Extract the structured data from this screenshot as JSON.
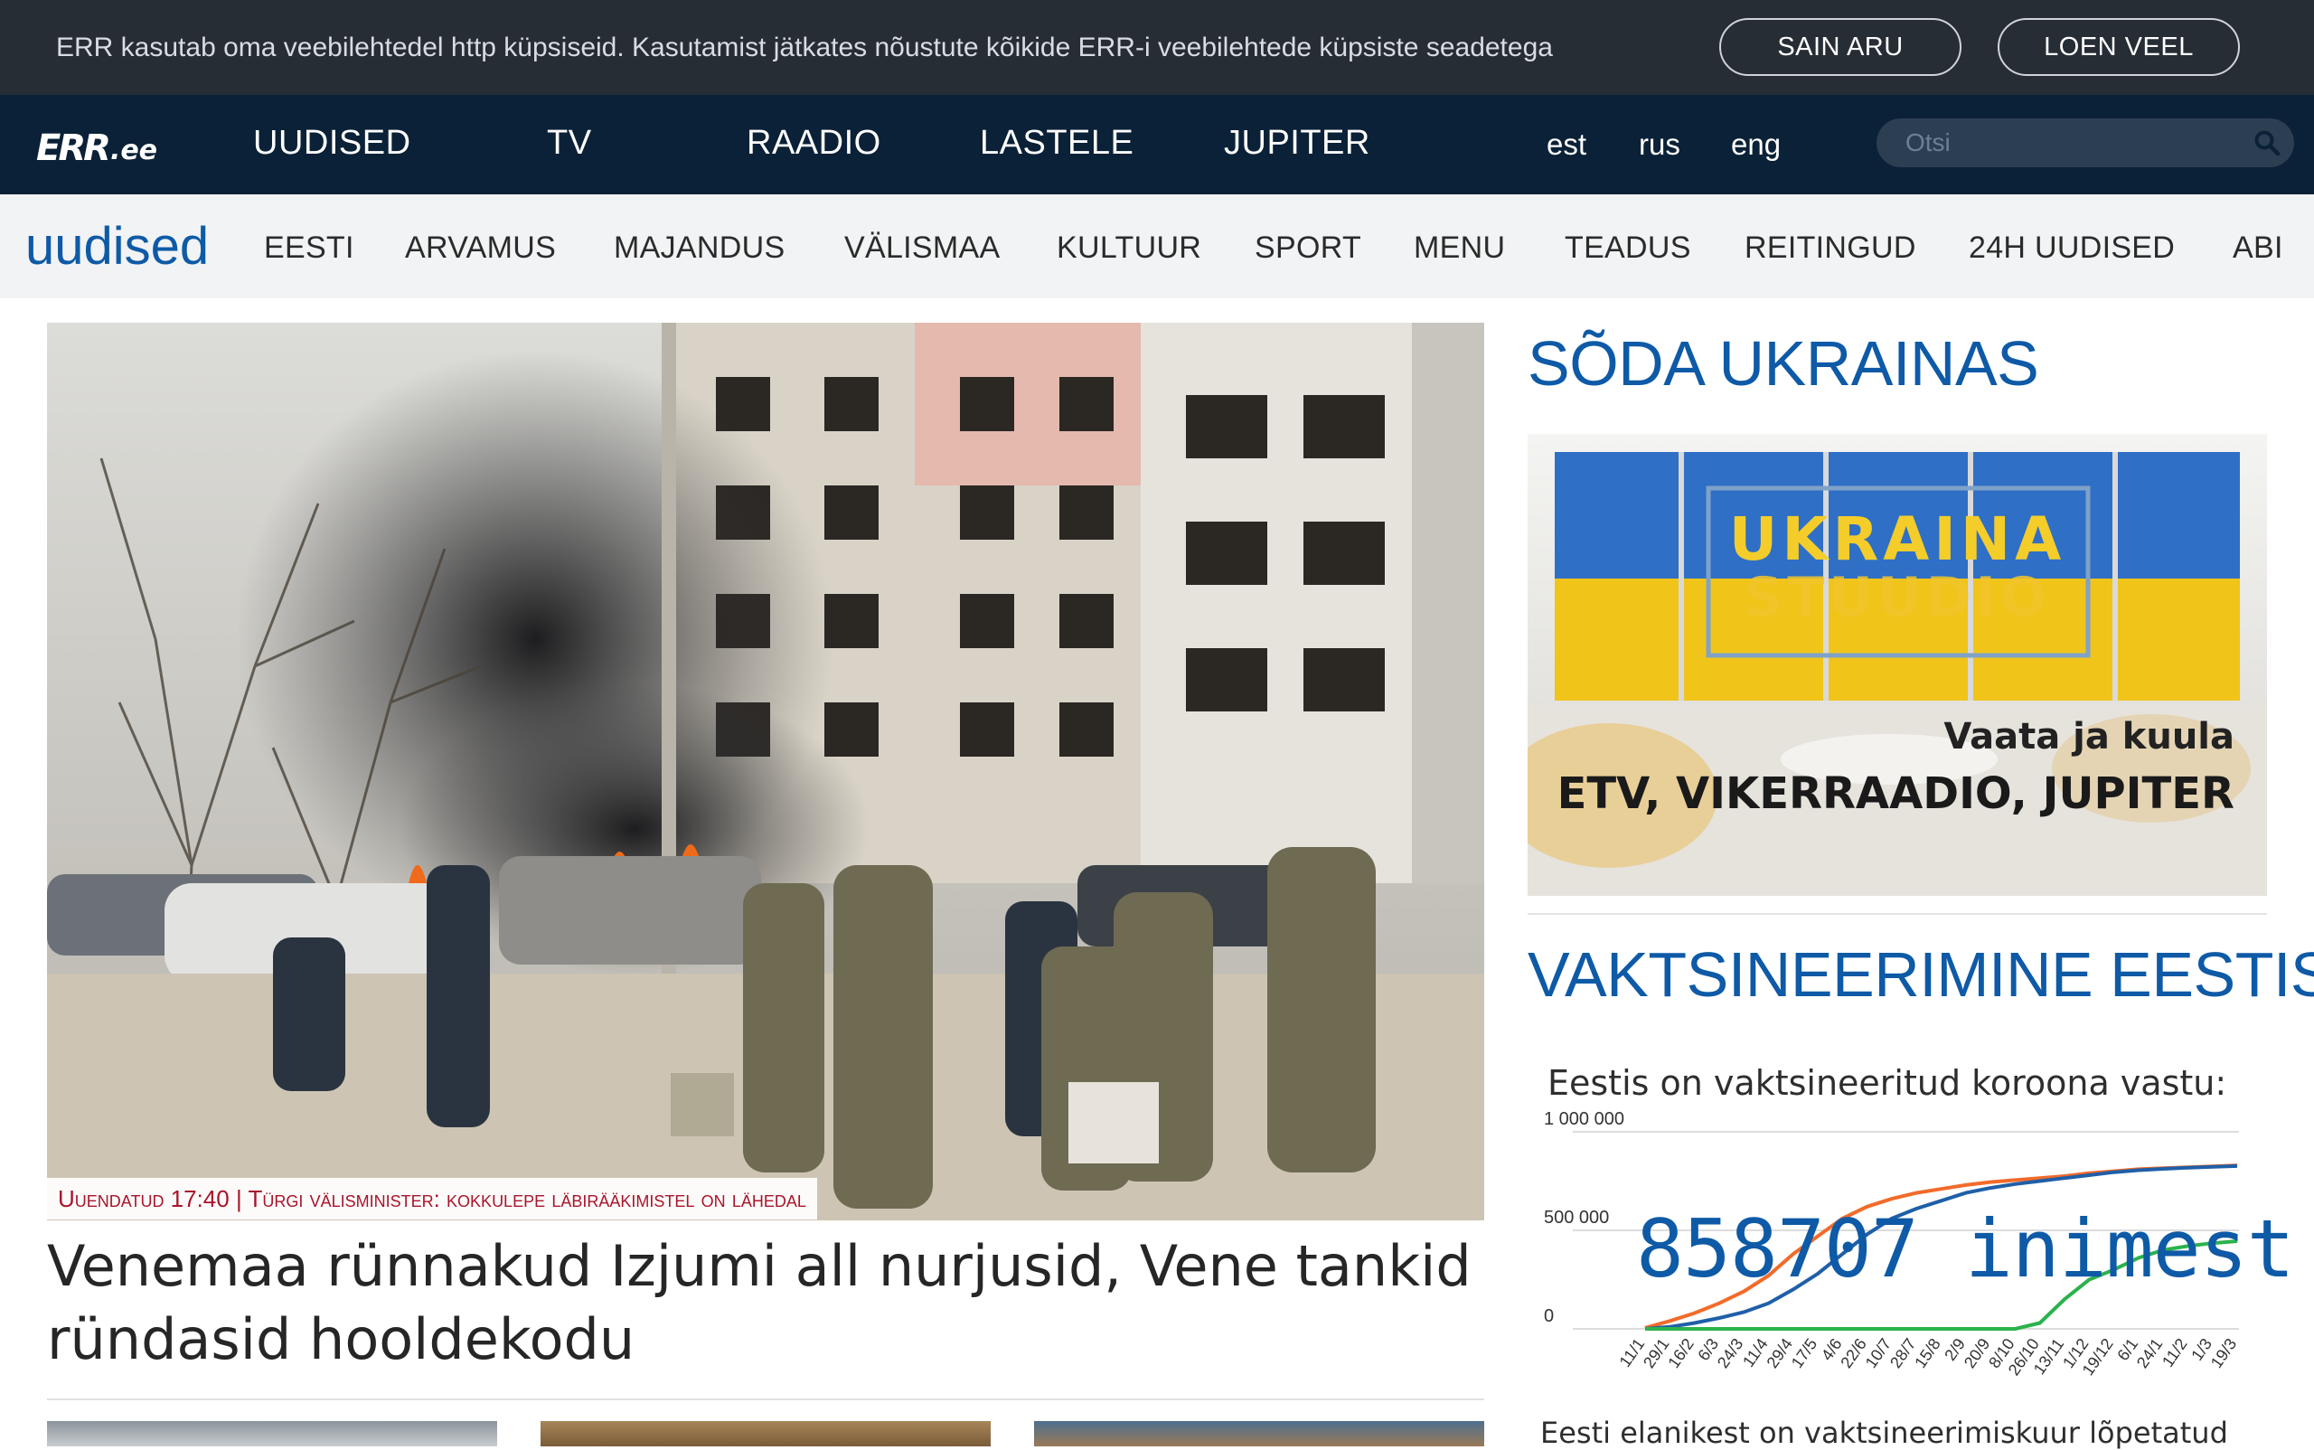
{
  "cookie": {
    "message": "ERR kasutab oma veebilehtedel http küpsiseid. Kasutamist jätkates nõustute kõikide ERR-i veebilehtede küpsiste seadetega",
    "accept_label": "SAIN ARU",
    "more_label": "LOEN VEEL"
  },
  "topnav": {
    "logo_mark": "ERR",
    "logo_domain": ".ee",
    "items": [
      "UUDISED",
      "TV",
      "RAADIO",
      "LASTELE",
      "JUPITER"
    ],
    "languages": [
      "est",
      "rus",
      "eng"
    ],
    "search_placeholder": "Otsi",
    "search_icon": "search-icon"
  },
  "subnav": {
    "brand": "uudised",
    "items": [
      "EESTI",
      "ARVAMUS",
      "MAJANDUS",
      "VÄLISMAA",
      "KULTUUR",
      "SPORT",
      "MENU",
      "TEADUS",
      "REITINGUD",
      "24H UUDISED",
      "ABI"
    ]
  },
  "hero": {
    "caption": "Uuendatud 17:40 | Türgi välisminister: kokkulepe läbirääkimistel on lähedal",
    "headline": "Venemaa rünnakud Izjumi all nurjusid, Vene tankid ründasid hooldekodu"
  },
  "sidebar": {
    "war_heading": "SÕDA UKRAINAS",
    "banner": {
      "line1": "UKRAINA",
      "line2": "STUUDIO",
      "line3": "Vaata ja kuula",
      "line4": "ETV, VIKERRAADIO, JUPITER"
    },
    "vaccine_heading": "VAKTSINEERIMINE EESTIS",
    "vaccine_subtitle": "Eestis on vaktsineeritud koroona vastu:",
    "vaccine_count": "858707 inimest",
    "vaccine_footer": "Eesti elanikest on vaktsineerimiskuur lõpetatud"
  },
  "chart_data": {
    "type": "line",
    "title": "",
    "xlabel": "",
    "ylabel": "",
    "ylim": [
      0,
      1000000
    ],
    "y_ticks": [
      "0",
      "500 000",
      "1 000 000"
    ],
    "categories": [
      "11/1",
      "29/1",
      "16/2",
      "6/3",
      "24/3",
      "11/4",
      "29/4",
      "17/5",
      "4/6",
      "22/6",
      "10/7",
      "28/7",
      "15/8",
      "2/9",
      "20/9",
      "8/10",
      "26/10",
      "13/11",
      "1/12",
      "19/12",
      "6/1",
      "24/1",
      "11/2",
      "1/3",
      "19/3"
    ],
    "series": [
      {
        "color": "#f26b2a",
        "values": [
          5000,
          40000,
          80000,
          130000,
          190000,
          270000,
          380000,
          470000,
          560000,
          620000,
          660000,
          690000,
          710000,
          730000,
          745000,
          755000,
          765000,
          775000,
          790000,
          800000,
          810000,
          815000,
          820000,
          825000,
          830000
        ]
      },
      {
        "color": "#1f5fa8",
        "values": [
          0,
          10000,
          30000,
          55000,
          85000,
          130000,
          200000,
          280000,
          380000,
          480000,
          560000,
          610000,
          650000,
          690000,
          715000,
          735000,
          750000,
          765000,
          780000,
          795000,
          805000,
          812000,
          818000,
          822000,
          826000
        ]
      },
      {
        "color": "#2bb24c",
        "values": [
          0,
          0,
          0,
          0,
          0,
          0,
          0,
          0,
          0,
          0,
          0,
          0,
          0,
          0,
          0,
          0,
          30000,
          150000,
          250000,
          300000,
          360000,
          400000,
          420000,
          435000,
          445000
        ]
      }
    ]
  }
}
